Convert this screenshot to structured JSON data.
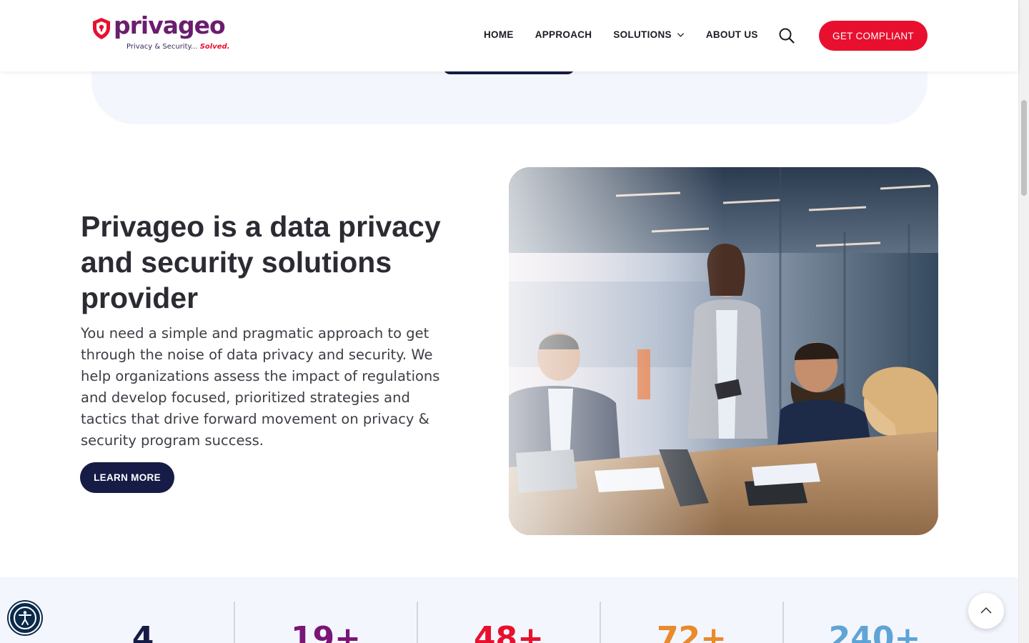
{
  "brand": {
    "name": "privageo",
    "tagline_main": "Privacy & Security...",
    "tagline_accent": "Solved.",
    "primary_color": "#6b1d6f",
    "accent_color": "#e8102e",
    "navy_color": "#161c45"
  },
  "nav": {
    "items": [
      {
        "label": "HOME"
      },
      {
        "label": "APPROACH"
      },
      {
        "label": "SOLUTIONS",
        "has_dropdown": true
      },
      {
        "label": "ABOUT US"
      }
    ],
    "search_icon": "search-icon",
    "cta_label": "GET COMPLIANT"
  },
  "about": {
    "title": "Privageo is a data privacy and security solutions provider",
    "description": "You need a simple and pragmatic approach to get through the noise of data privacy and security. We help organizations assess the impact of regulations and develop focused, prioritized strategies and tactics that drive forward movement on privacy & security program success.",
    "button_label": "LEARN MORE",
    "image_icon": "team-meeting-photo"
  },
  "stats": [
    {
      "value": "4",
      "color": "#161c45"
    },
    {
      "value": "19+",
      "color": "#7a1576"
    },
    {
      "value": "48+",
      "color": "#e8102e"
    },
    {
      "value": "72+",
      "color": "#e98a2c"
    },
    {
      "value": "240+",
      "color": "#5fa4d6"
    }
  ],
  "floating": {
    "accessibility_icon": "accessibility-icon",
    "back_to_top_icon": "chevron-up-icon"
  }
}
